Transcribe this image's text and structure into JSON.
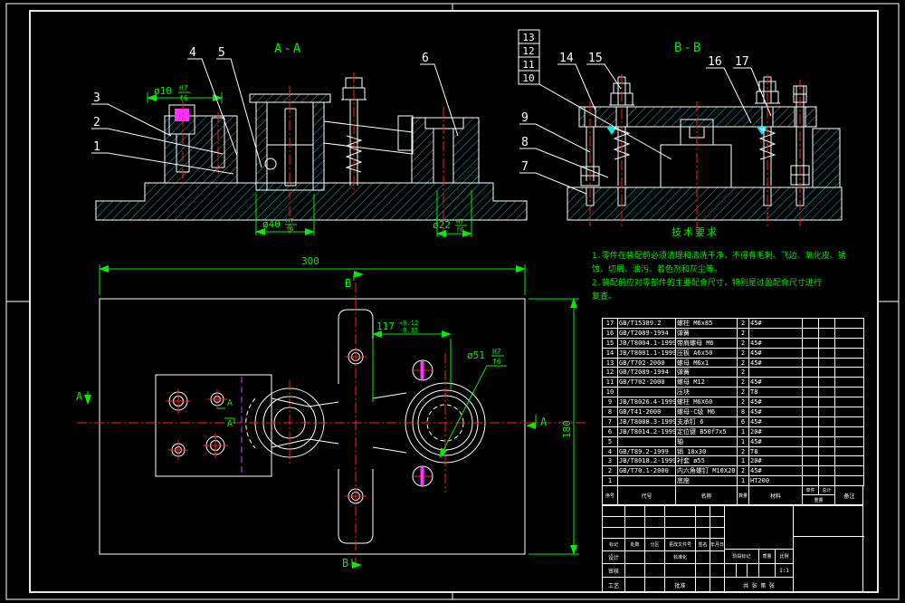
{
  "sheet": {
    "type": "engineering-assembly-drawing",
    "colors": {
      "background": "#000000",
      "outline": "#ffffff",
      "hatch": "#19e5e5",
      "centerline": "#ff2020",
      "dimension": "#00ee00",
      "fastener_detail": "#ff30ff",
      "section_fold_line": "#cc44ff"
    }
  },
  "views": {
    "aa": {
      "label": "A-A",
      "balloons": {
        "b1": "1",
        "b2": "2",
        "b3": "3",
        "b4": "4",
        "b5": "5",
        "b6": "6"
      },
      "dims": {
        "d10": {
          "p": "ø10",
          "u": "H7",
          "l": "f6"
        },
        "d40": {
          "p": "ø40",
          "u": "H7",
          "l": "f6"
        },
        "d22": {
          "p": "ø22",
          "u": "H7",
          "l": "f6"
        }
      }
    },
    "bb": {
      "label": "B-B",
      "balloons": {
        "b7": "7",
        "b8": "8",
        "b9": "9",
        "b10": "10",
        "b11": "11",
        "b12": "12",
        "b13": "13",
        "b14": "14",
        "b15": "15",
        "b16": "16",
        "b17": "17"
      }
    },
    "plan": {
      "dims": {
        "d300": "300",
        "d180": "180",
        "d117": {
          "v": "117",
          "u": "+0.12",
          "l": "-0.35"
        },
        "d51": {
          "p": "ø51",
          "u": "H7",
          "l": "f6"
        }
      },
      "markers": {
        "a": "A",
        "b": "B"
      }
    }
  },
  "notes": {
    "title": "技术要求",
    "lines": [
      {
        "t": "1.零件在装配前必须清理和清洗干净，不得有毛刺、飞边、氧化皮、锈"
      },
      {
        "t": "蚀、切屑、油污、着色剂和灰尘等。"
      },
      {
        "t": "2.装配前应对零部件的主要配合尺寸，特别是过盈配合尺寸进行"
      },
      {
        "t": "复查。"
      }
    ]
  },
  "bom": {
    "rows": [
      {
        "no": "17",
        "code": "GB/T15389.2",
        "name": "螺柱 M6x85",
        "qty": "2",
        "material": "45#"
      },
      {
        "no": "16",
        "code": "GB/T2089-1994",
        "name": "弹簧",
        "qty": "2",
        "material": ""
      },
      {
        "no": "15",
        "code": "JB/T8004.1-1999",
        "name": "带肩螺母 M6",
        "qty": "2",
        "material": "45#"
      },
      {
        "no": "14",
        "code": "JB/T8001.1-1999",
        "name": "压板 A6x50",
        "qty": "2",
        "material": "45#"
      },
      {
        "no": "13",
        "code": "GB/T702-2000",
        "name": "螺母 M6x1",
        "qty": "2",
        "material": "45#"
      },
      {
        "no": "12",
        "code": "GB/T2089-1994",
        "name": "弹簧",
        "qty": "2",
        "material": ""
      },
      {
        "no": "11",
        "code": "GB/T702-2000",
        "name": "螺母 M12",
        "qty": "2",
        "material": "45#"
      },
      {
        "no": "10",
        "code": "",
        "name": "压块",
        "qty": "2",
        "material": "T8"
      },
      {
        "no": "9",
        "code": "JB/T8026.4-1999",
        "name": "螺柱 M6X60",
        "qty": "2",
        "material": "45#"
      },
      {
        "no": "8",
        "code": "GB/T41-2000",
        "name": "螺母-C级 M6",
        "qty": "8",
        "material": "45#"
      },
      {
        "no": "7",
        "code": "JB/T8008.3-1999",
        "name": "支承钉 6",
        "qty": "6",
        "material": "45#"
      },
      {
        "no": "6",
        "code": "JB/T8014.2-1999",
        "name": "定位键 B50f7x5",
        "qty": "1",
        "material": "20#"
      },
      {
        "no": "5",
        "code": "",
        "name": "轴",
        "qty": "1",
        "material": "45#"
      },
      {
        "no": "4",
        "code": "GB/T89.2-1999",
        "name": "销 10x30",
        "qty": "2",
        "material": "T8"
      },
      {
        "no": "3",
        "code": "JB/T8018.2-1999",
        "name": "衬套 ø55",
        "qty": "1",
        "material": "20#"
      },
      {
        "no": "2",
        "code": "GB/T70.1-2000",
        "name": "内六角螺钉 M10X20",
        "qty": "2",
        "material": "45#"
      },
      {
        "no": "1",
        "code": "",
        "name": "底座",
        "qty": "1",
        "material": "HT200"
      }
    ],
    "footer": {
      "no": "序号",
      "code": "代号",
      "name": "名称",
      "qty": "数量",
      "material": "材料",
      "unit": "单件",
      "total": "总计",
      "weight": "重量",
      "remark": "备注"
    }
  },
  "title_block": {
    "mark": "标记",
    "count": "处数",
    "zone": "分区",
    "doc_no": "更改文件号",
    "sign": "签名",
    "date": "年月日",
    "design": "设计",
    "standard": "标准化",
    "audit": "审核",
    "process": "工艺",
    "approve": "批准",
    "stage": "阶段标记",
    "weight": "质量",
    "scale": "比例",
    "scale_value": "1:1",
    "sheets": "共 张 第 张"
  }
}
